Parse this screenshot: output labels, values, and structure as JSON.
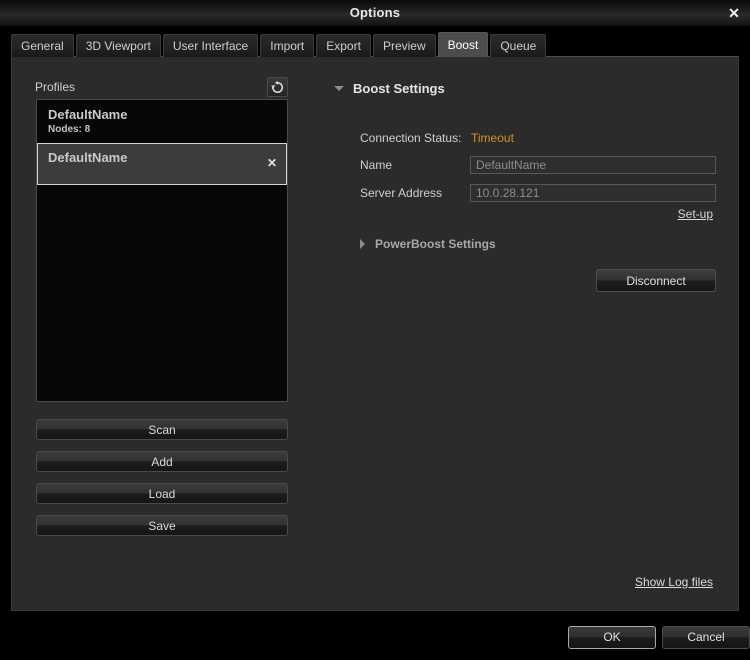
{
  "window": {
    "title": "Options",
    "close_icon": "close-icon",
    "close_label": "✕"
  },
  "tabs": [
    {
      "label": "General",
      "active": false
    },
    {
      "label": "3D Viewport",
      "active": false
    },
    {
      "label": "User Interface",
      "active": false
    },
    {
      "label": "Import",
      "active": false
    },
    {
      "label": "Export",
      "active": false
    },
    {
      "label": "Preview",
      "active": false
    },
    {
      "label": "Boost",
      "active": true
    },
    {
      "label": "Queue",
      "active": false
    }
  ],
  "profiles_panel": {
    "label": "Profiles",
    "refresh_icon": "refresh-icon",
    "items": [
      {
        "name": "DefaultName",
        "sub": "Nodes: 8",
        "selected": false,
        "close_label": ""
      },
      {
        "name": "DefaultName",
        "sub": "",
        "selected": true,
        "close_label": "✕"
      }
    ],
    "buttons": {
      "scan": "Scan",
      "add": "Add",
      "load": "Load",
      "save": "Save"
    }
  },
  "boost_settings": {
    "section_title": "Boost Settings",
    "expanded": true,
    "connection_status_label": "Connection Status:",
    "connection_status_value": "Timeout",
    "connection_status_color": "#d59220",
    "name_label": "Name",
    "name_value": "",
    "name_placeholder": "DefaultName",
    "server_label": "Server Address",
    "server_value": "",
    "server_placeholder": "10.0.28.121",
    "setup_link": "Set-up",
    "disconnect_label": "Disconnect"
  },
  "powerboost_settings": {
    "section_title": "PowerBoost Settings",
    "expanded": false
  },
  "footer": {
    "show_log_link": "Show Log files",
    "ok_label": "OK",
    "cancel_label": "Cancel"
  }
}
